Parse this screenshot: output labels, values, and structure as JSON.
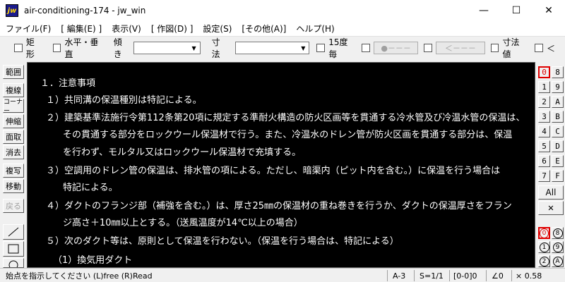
{
  "window": {
    "icon_text": "jw",
    "title": "air-conditioning-174 - jw_win",
    "minimize": "—",
    "maximize": "☐",
    "close": "✕"
  },
  "menu": [
    "ファイル(F)",
    "[ 編集(E) ]",
    "表示(V)",
    "[ 作図(D) ]",
    "設定(S)",
    "[その他(A)]",
    "ヘルプ(H)"
  ],
  "toolbar": {
    "rect_label": "矩形",
    "hv_label": "水平・垂直",
    "tilt_label": "傾き",
    "tilt_value": "",
    "dim_label": "寸法",
    "dim_value": "",
    "deg15_label": "15度毎",
    "btn_dot": "●－－－",
    "btn_arrow": "＜－－－",
    "dimval_label": "寸法値",
    "lt_label": "＜"
  },
  "left_tools": [
    "範囲",
    "複線",
    "コーナー",
    "伸縮",
    "面取",
    "消去",
    "複写",
    "移動",
    "戻る"
  ],
  "canvas_text": [
    "１．注意事項",
    "１）共同溝の保温種別は特記による。",
    "２）建築基準法施行令第112条第20項に規定する準耐火構造の防火区画等を貫通する冷水管及び冷温水管の保温は、",
    "その貫通する部分をロックウール保温材で行う。また、冷温水のドレン管が防火区画を貫通する部分は、保温",
    "を行わず、モルタル又はロックウール保温材で充填する。",
    "３）空調用のドレン管の保温は、排水管の項による。ただし、暗渠内（ピット内を含む。）に保温を行う場合は",
    "特記による。",
    "４）ダクトのフランジ部（補強を含む。）は、厚さ25㎜の保温材の重ね巻きを行うか、ダクトの保温厚さをフラン",
    "ジ高さ＋10㎜以上とする。（送風温度が14℃以上の場合）",
    "５）次のダクト等は、原則として保温を行わない。（保温を行う場合は、特記による）",
    "（1）換気用ダクト"
  ],
  "layers": [
    "0",
    "8",
    "1",
    "9",
    "2",
    "A",
    "3",
    "B",
    "4",
    "C",
    "5",
    "D",
    "6",
    "E",
    "7",
    "F"
  ],
  "layer_all": "All",
  "layer_x": "✕",
  "groups": [
    "0",
    "8",
    "1",
    "9",
    "2",
    "A"
  ],
  "status": {
    "prompt": "始点を指示してください (L)free (R)Read",
    "paper": "A-3",
    "scale": "S=1/1",
    "layer": "[0-0]0",
    "angle": "∠0",
    "factor": "× 0.58"
  },
  "colors": {
    "canvas_bg": "#000000",
    "canvas_text": "#ffffff",
    "active_layer": "#e00000"
  }
}
